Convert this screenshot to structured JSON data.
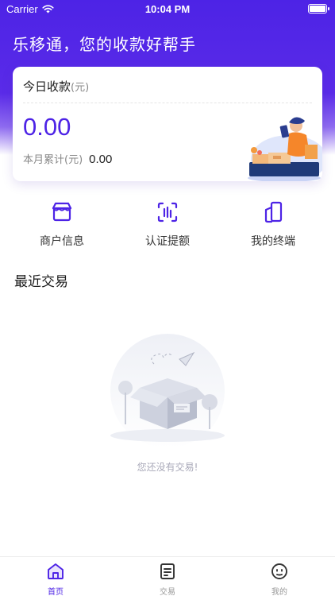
{
  "status_bar": {
    "carrier": "Carrier",
    "time": "10:04 PM"
  },
  "app": {
    "title": "乐移通，您的收款好帮手",
    "brand_color": "#4d23e6"
  },
  "today_card": {
    "title": "今日收款",
    "unit": "(元)",
    "amount": "0.00",
    "month_label": "本月累计(元)",
    "month_value": "0.00"
  },
  "quick_actions": [
    {
      "label": "商户信息",
      "icon": "store-icon"
    },
    {
      "label": "认证提额",
      "icon": "verify-limit-icon"
    },
    {
      "label": "我的终端",
      "icon": "terminal-device-icon"
    }
  ],
  "recent": {
    "title": "最近交易",
    "empty_text": "您还没有交易!"
  },
  "tabbar": {
    "items": [
      {
        "label": "首页",
        "icon": "home-icon",
        "active": true
      },
      {
        "label": "交易",
        "icon": "transaction-list-icon",
        "active": false
      },
      {
        "label": "我的",
        "icon": "profile-face-icon",
        "active": false
      }
    ]
  }
}
